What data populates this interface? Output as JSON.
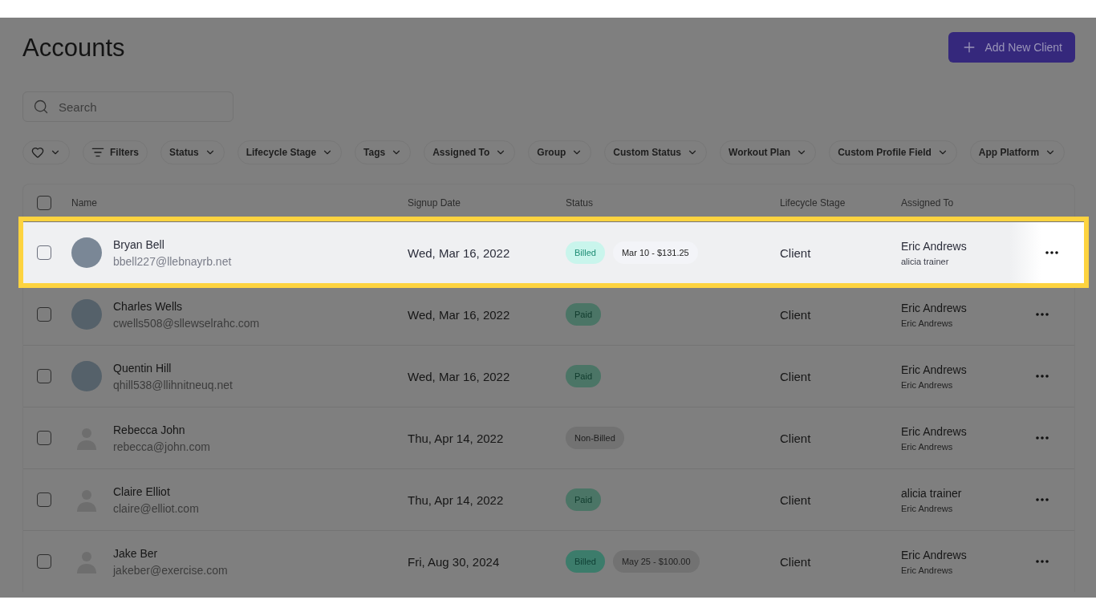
{
  "page": {
    "title": "Accounts",
    "add_button": "Add New Client"
  },
  "search": {
    "placeholder": "Search"
  },
  "filters": [
    {
      "kind": "favorite"
    },
    {
      "kind": "filters",
      "label": "Filters"
    },
    {
      "kind": "dropdown",
      "label": "Status"
    },
    {
      "kind": "dropdown",
      "label": "Lifecycle Stage"
    },
    {
      "kind": "dropdown",
      "label": "Tags"
    },
    {
      "kind": "dropdown",
      "label": "Assigned To"
    },
    {
      "kind": "dropdown",
      "label": "Group"
    },
    {
      "kind": "dropdown",
      "label": "Custom Status"
    },
    {
      "kind": "dropdown",
      "label": "Workout Plan"
    },
    {
      "kind": "dropdown",
      "label": "Custom Profile Field"
    },
    {
      "kind": "dropdown",
      "label": "App Platform"
    }
  ],
  "table": {
    "select_all_checked": false,
    "columns": [
      "Name",
      "Signup Date",
      "Status",
      "Lifecycle Stage",
      "Assigned To"
    ],
    "rows": [
      {
        "highlighted": true,
        "checked": false,
        "avatar": {
          "kind": "photo"
        },
        "name": "Bryan Bell",
        "email": "bbell227@llebnayrb.net",
        "signup": "Wed, Mar 16, 2022",
        "status": {
          "kind": "billed",
          "label": "Billed"
        },
        "invoice": "Mar 10 - $131.25",
        "stage": "Client",
        "assigned": "Eric Andrews",
        "assigned_sub": "alicia trainer"
      },
      {
        "highlighted": false,
        "checked": false,
        "avatar": {
          "kind": "photo"
        },
        "name": "Charles Wells",
        "email": "cwells508@sllewselrahc.com",
        "signup": "Wed, Mar 16, 2022",
        "status": {
          "kind": "paid",
          "label": "Paid"
        },
        "stage": "Client",
        "assigned": "Eric Andrews",
        "assigned_sub": "Eric Andrews"
      },
      {
        "highlighted": false,
        "checked": false,
        "avatar": {
          "kind": "photo"
        },
        "name": "Quentin Hill",
        "email": "qhill538@llihnitneuq.net",
        "signup": "Wed, Mar 16, 2022",
        "status": {
          "kind": "paid",
          "label": "Paid"
        },
        "stage": "Client",
        "assigned": "Eric Andrews",
        "assigned_sub": "Eric Andrews"
      },
      {
        "highlighted": false,
        "checked": false,
        "avatar": {
          "kind": "silhouette"
        },
        "name": "Rebecca John",
        "email": "rebecca@john.com",
        "signup": "Thu, Apr 14, 2022",
        "status": {
          "kind": "nonbilled",
          "label": "Non-Billed"
        },
        "stage": "Client",
        "assigned": "Eric Andrews",
        "assigned_sub": "Eric Andrews"
      },
      {
        "highlighted": false,
        "checked": false,
        "avatar": {
          "kind": "silhouette"
        },
        "name": "Claire Elliot",
        "email": "claire@elliot.com",
        "signup": "Thu, Apr 14, 2022",
        "status": {
          "kind": "paid",
          "label": "Paid"
        },
        "stage": "Client",
        "assigned": "alicia trainer",
        "assigned_sub": "Eric Andrews"
      },
      {
        "highlighted": false,
        "checked": false,
        "avatar": {
          "kind": "silhouette"
        },
        "name": "Jake Ber",
        "email": "jakeber@exercise.com",
        "signup": "Fri, Aug 30, 2024",
        "status": {
          "kind": "billed",
          "label": "Billed"
        },
        "invoice": "May 25 - $100.00",
        "stage": "Client",
        "assigned": "Eric Andrews",
        "assigned_sub": "Eric Andrews"
      }
    ]
  }
}
